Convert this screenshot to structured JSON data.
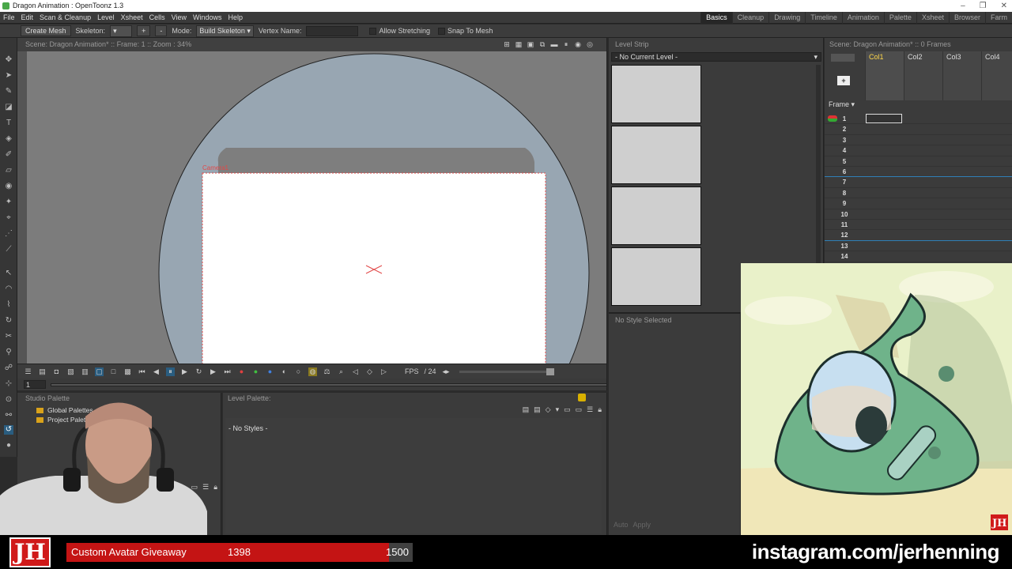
{
  "window": {
    "title": "Dragon Animation : OpenToonz 1.3",
    "controls": [
      "–",
      "❐",
      "✕"
    ]
  },
  "menu": {
    "items": [
      "File",
      "Edit",
      "Scan & Cleanup",
      "Level",
      "Xsheet",
      "Cells",
      "View",
      "Windows",
      "Help"
    ]
  },
  "rooms": {
    "items": [
      "Basics",
      "Cleanup",
      "Drawing",
      "Timeline",
      "Animation",
      "Palette",
      "Xsheet",
      "Browser",
      "Farm"
    ],
    "active": "Basics"
  },
  "tool_options": {
    "create_mesh": "Create Mesh",
    "skeleton_label": "Skeleton:",
    "plus": "+",
    "minus": "-",
    "mode_label": "Mode:",
    "mode_value": "Build Skeleton",
    "vertex_label": "Vertex Name:",
    "allow_stretching": "Allow Stretching",
    "snap_to_mesh": "Snap To Mesh"
  },
  "viewer": {
    "header": "Scene: Dragon Animation*  ::  Frame: 1  ::  Zoom : 34%",
    "camera_label": "Camera1",
    "fps_label": "FPS",
    "fps_value": "/ 24",
    "frame_value": "1"
  },
  "level_strip": {
    "title": "Level Strip",
    "current_level": "- No Current Level -",
    "cell_count": 4
  },
  "style_editor": {
    "title": "No Style Selected",
    "auto": "Auto",
    "apply": "Apply"
  },
  "xsheet": {
    "header": "Scene: Dragon Animation*  ::  0 Frames",
    "columns": [
      "Col1",
      "Col2",
      "Col3",
      "Col4"
    ],
    "frame_label": "Frame",
    "frames": [
      "1",
      "2",
      "3",
      "4",
      "5",
      "6",
      "7",
      "8",
      "9",
      "10",
      "11",
      "12",
      "13",
      "14"
    ]
  },
  "studio_palette": {
    "title": "Studio Palette",
    "items": [
      "Global Palettes",
      "Project Palettes"
    ]
  },
  "level_palette": {
    "title": "Level Palette:",
    "empty": "- No Styles -"
  },
  "overlay": {
    "logo": "JH",
    "giveaway_label": "Custom Avatar Giveaway",
    "giveaway_count": "1398",
    "giveaway_goal": "1500",
    "progress_fraction": 0.932,
    "instagram": "instagram.com/jerhenning",
    "art_badge": "JH"
  },
  "colors": {
    "accent": "#2a5d80",
    "brand_red": "#c41414",
    "col_highlight": "#ffd84a"
  }
}
